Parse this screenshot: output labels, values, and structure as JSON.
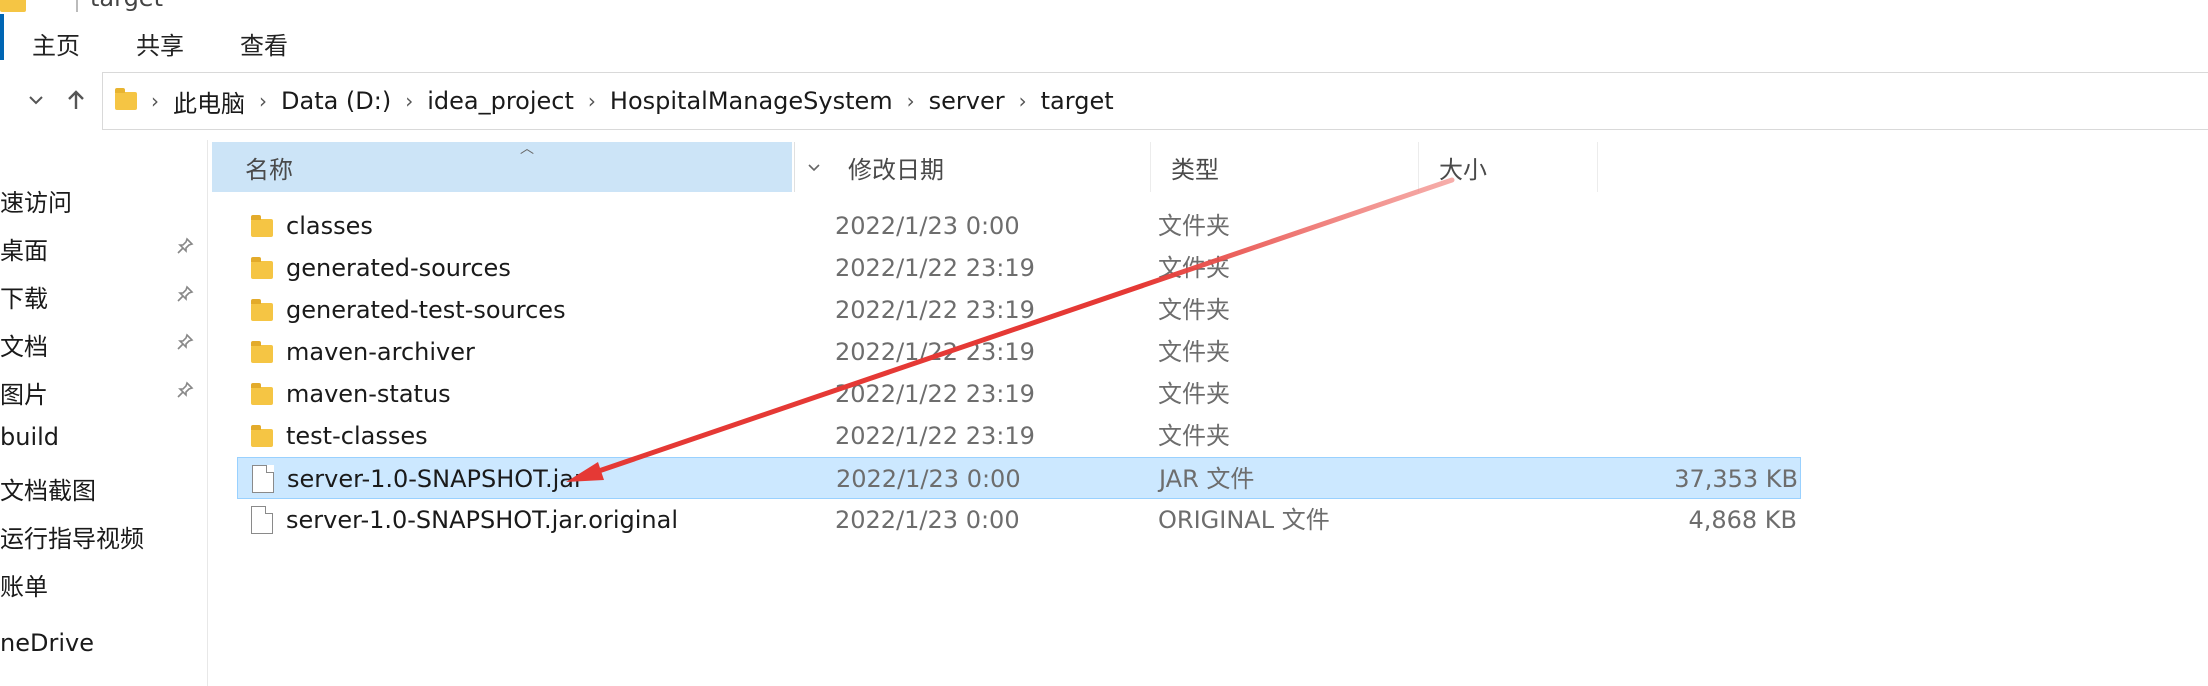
{
  "window": {
    "title_fragment": "target"
  },
  "ribbon": {
    "tabs": [
      "主页",
      "共享",
      "查看"
    ]
  },
  "address_bar": {
    "segments": [
      "此电脑",
      "Data (D:)",
      "idea_project",
      "HospitalManageSystem",
      "server",
      "target"
    ]
  },
  "nav_pane": {
    "items": [
      {
        "label": "速访问",
        "pinned": false
      },
      {
        "label": "桌面",
        "pinned": true
      },
      {
        "label": "下载",
        "pinned": true
      },
      {
        "label": "文档",
        "pinned": true
      },
      {
        "label": "图片",
        "pinned": true
      },
      {
        "label": "build",
        "pinned": false
      },
      {
        "label": "文档截图",
        "pinned": false
      },
      {
        "label": "运行指导视频",
        "pinned": false
      },
      {
        "label": "账单",
        "pinned": false
      },
      {
        "label": "neDrive",
        "pinned": false
      }
    ]
  },
  "columns": {
    "name": "名称",
    "date": "修改日期",
    "type": "类型",
    "size": "大小"
  },
  "files": [
    {
      "name": "classes",
      "date": "2022/1/23 0:00",
      "type": "文件夹",
      "size": "",
      "kind": "folder",
      "selected": false
    },
    {
      "name": "generated-sources",
      "date": "2022/1/22 23:19",
      "type": "文件夹",
      "size": "",
      "kind": "folder",
      "selected": false
    },
    {
      "name": "generated-test-sources",
      "date": "2022/1/22 23:19",
      "type": "文件夹",
      "size": "",
      "kind": "folder",
      "selected": false
    },
    {
      "name": "maven-archiver",
      "date": "2022/1/22 23:19",
      "type": "文件夹",
      "size": "",
      "kind": "folder",
      "selected": false
    },
    {
      "name": "maven-status",
      "date": "2022/1/22 23:19",
      "type": "文件夹",
      "size": "",
      "kind": "folder",
      "selected": false
    },
    {
      "name": "test-classes",
      "date": "2022/1/22 23:19",
      "type": "文件夹",
      "size": "",
      "kind": "folder",
      "selected": false
    },
    {
      "name": "server-1.0-SNAPSHOT.jar",
      "date": "2022/1/23 0:00",
      "type": "JAR 文件",
      "size": "37,353 KB",
      "kind": "file",
      "selected": true
    },
    {
      "name": "server-1.0-SNAPSHOT.jar.original",
      "date": "2022/1/23 0:00",
      "type": "ORIGINAL 文件",
      "size": "4,868 KB",
      "kind": "file",
      "selected": false
    }
  ],
  "colors": {
    "accent": "#0066b4",
    "selection": "#cce8ff",
    "header_active": "#cce4f7",
    "folder": "#f5c544",
    "annotation_arrow": "#e53935"
  },
  "icons": {
    "nav_down": "chevron-down-icon",
    "nav_up": "arrow-up-icon",
    "crumb_sep": "chevron-right-icon",
    "pin": "pin-icon"
  }
}
